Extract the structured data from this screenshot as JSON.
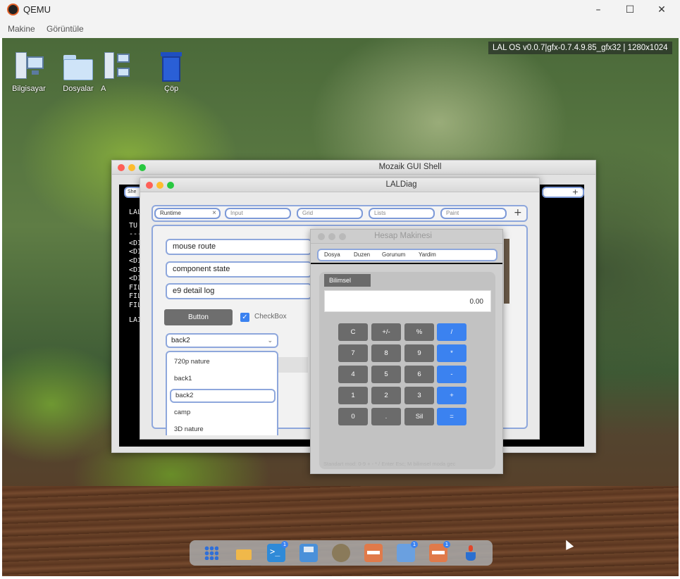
{
  "host": {
    "title": "QEMU",
    "menu": [
      "Makine",
      "Görüntüle"
    ],
    "controls": [
      "minimize",
      "maximize",
      "close"
    ]
  },
  "desktop": {
    "os_info": "LAL OS v0.0.7|gfx-0.7.4.9.85_gfx32 | 1280x1024",
    "icons": [
      {
        "label": "Bilgisayar",
        "icon": "computer-icon"
      },
      {
        "label": "Dosyalar",
        "icon": "folder-icon"
      },
      {
        "label": "A",
        "icon": "network-icon"
      },
      {
        "label": "Çöp",
        "icon": "trash-icon"
      }
    ]
  },
  "shell": {
    "title": "Mozaik GUI Shell",
    "tab_label": "She",
    "add_symbol": "+",
    "lines": [
      "LAL",
      "TU",
      "---",
      "<DI",
      "<DI",
      "<DI",
      "<DI",
      "<DI",
      "FILE",
      "FILE",
      "FILE",
      "LAI"
    ]
  },
  "laldiag": {
    "title": "LALDiag",
    "tabs": [
      "Runtime",
      "Input",
      "Grid",
      "Lists",
      "Paint"
    ],
    "tab_close": "×",
    "add_symbol": "+",
    "fields": [
      "mouse route",
      "component state",
      "e9 detail log"
    ],
    "button_label": "Button",
    "checkbox_label": "CheckBox",
    "checkbox_checked": true,
    "select_value": "back2",
    "dropdown_options": [
      "720p nature",
      "back1",
      "back2",
      "camp",
      "3D nature"
    ],
    "dropdown_selected": "back2"
  },
  "calculator": {
    "title": "Hesap Makinesi",
    "menu": [
      "Dosya",
      "Duzen",
      "Gorunum",
      "Yardim"
    ],
    "mode_tab": "Bilimsel",
    "display": "0.00",
    "keys": [
      [
        "C",
        "+/-",
        "%",
        "/"
      ],
      [
        "7",
        "8",
        "9",
        "*"
      ],
      [
        "4",
        "5",
        "6",
        "-"
      ],
      [
        "1",
        "2",
        "3",
        "+"
      ],
      [
        "0",
        ".",
        "Sil",
        "="
      ]
    ],
    "footer": "Standart mod: 0-9 + - * / Enter Esc; M bilimsel moda gec"
  },
  "dock": {
    "items": [
      {
        "icon": "apps-grid-icon"
      },
      {
        "icon": "folder-icon"
      },
      {
        "icon": "terminal-icon",
        "badge": "1"
      },
      {
        "icon": "save-editor-icon"
      },
      {
        "icon": "gallery-icon"
      },
      {
        "icon": "system-tool-icon"
      },
      {
        "icon": "file-manager-icon",
        "badge": "1"
      },
      {
        "icon": "system-tool-icon",
        "badge": "1"
      },
      {
        "icon": "java-icon"
      }
    ]
  }
}
